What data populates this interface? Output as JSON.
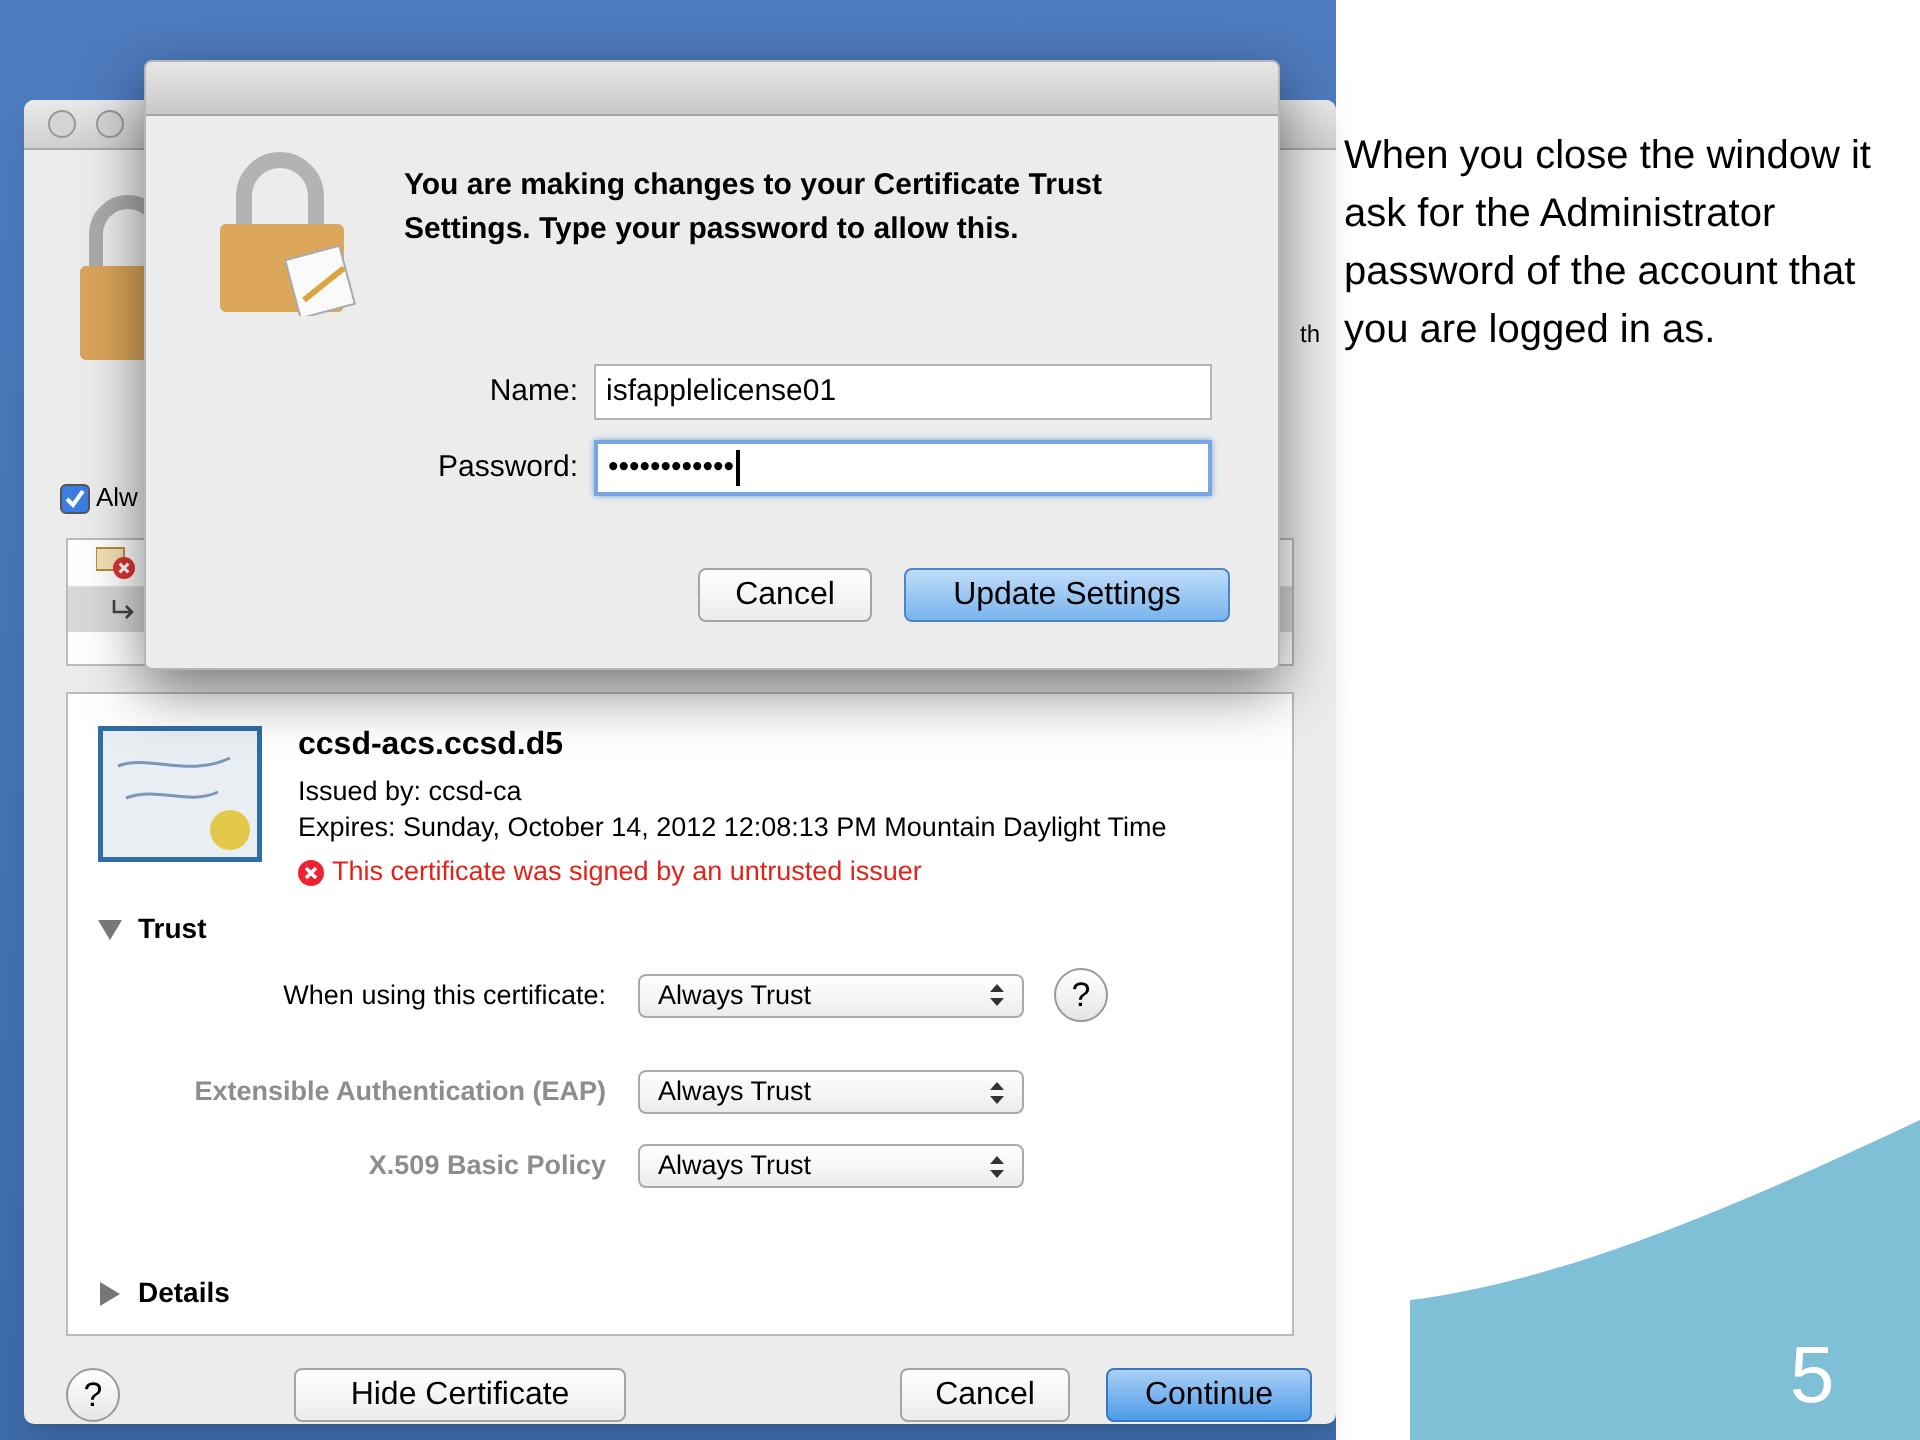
{
  "slide": {
    "note": "When you close the window it ask for the Administrator password of the account that you are logged in as.",
    "page_number": "5"
  },
  "back_window": {
    "fragment": "th",
    "checkbox": {
      "label": "Alw",
      "checked": true
    },
    "certificate": {
      "name": "ccsd-acs.ccsd.d5",
      "issued_by": "Issued by: ccsd-ca",
      "expires": "Expires: Sunday, October 14, 2012 12:08:13 PM Mountain Daylight Time",
      "warning": "This certificate was signed by an untrusted issuer"
    },
    "trust": {
      "label": "Trust",
      "expanded": true,
      "rows": [
        {
          "label": "When using this certificate:",
          "value": "Always Trust",
          "disabled": false,
          "help": "?"
        },
        {
          "label": "Extensible Authentication (EAP)",
          "value": "Always Trust",
          "disabled": true
        },
        {
          "label": "X.509 Basic Policy",
          "value": "Always Trust",
          "disabled": true
        }
      ]
    },
    "details": {
      "label": "Details",
      "expanded": false
    },
    "help": "?",
    "buttons": [
      {
        "label": "Hide Certificate",
        "default": false
      },
      {
        "label": "Cancel",
        "default": false
      },
      {
        "label": "Continue",
        "default": true
      }
    ]
  },
  "dialog": {
    "message": "You are making changes to your Certificate Trust Settings. Type your password to allow this.",
    "fields": [
      {
        "label": "Name:",
        "value": "isfapplelicense01",
        "focused": false
      },
      {
        "label": "Password:",
        "value": "••••••••••••",
        "focused": true
      }
    ],
    "buttons": [
      {
        "label": "Cancel",
        "default": false
      },
      {
        "label": "Update Settings",
        "default": true
      }
    ]
  }
}
